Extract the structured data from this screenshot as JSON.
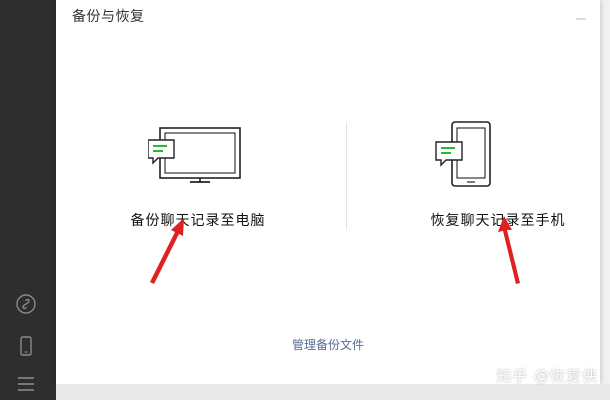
{
  "dialog": {
    "title": "备份与恢复",
    "close_icon": "close-icon"
  },
  "options": {
    "backup": {
      "label": "备份聊天记录至电脑",
      "icon": "monitor-chat-icon"
    },
    "restore": {
      "label": "恢复聊天记录至手机",
      "icon": "phone-chat-icon"
    }
  },
  "manage_link": "管理备份文件",
  "sidebar": {
    "icons": [
      "mini-program-icon",
      "phone-icon",
      "menu-icon"
    ]
  },
  "watermark": "知乎 @恢复侠",
  "colors": {
    "sidebar_bg": "#2e2e2e",
    "link": "#576b95",
    "arrow": "#e02020",
    "chat_green": "#1aad19"
  }
}
